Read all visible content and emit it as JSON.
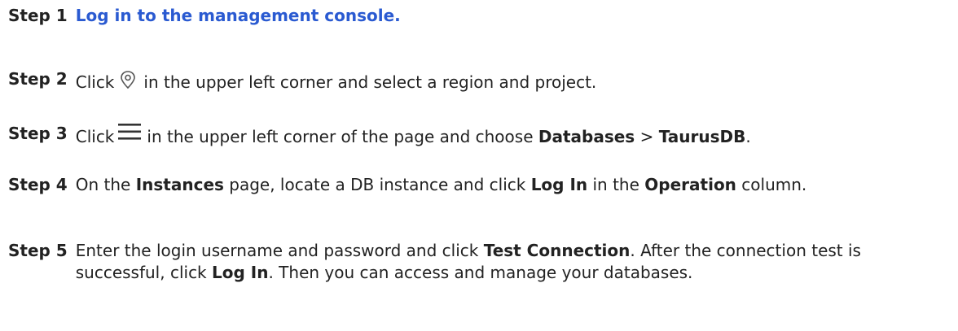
{
  "steps": [
    {
      "label": "Step 1",
      "link": "Log in to the management console."
    },
    {
      "label": "Step 2",
      "before_icon": "Click",
      "icon": "location-pin-icon",
      "after_icon": "in the upper left corner and select a region and project."
    },
    {
      "label": "Step 3",
      "before_icon": "Click",
      "icon": "hamburger-menu-icon",
      "text_a": "in the upper left corner of the page and choose",
      "bold_a": "Databases",
      "sep": ">",
      "bold_b": "TaurusDB",
      "text_end": "."
    },
    {
      "label": "Step 4",
      "text_a": "On the",
      "bold_a": "Instances",
      "text_b": "page, locate a DB instance and click",
      "bold_b": "Log In",
      "text_c": "in the",
      "bold_c": "Operation",
      "text_d": "column."
    },
    {
      "label": "Step 5",
      "text_a": "Enter the login username and password and click",
      "bold_a": "Test Connection",
      "text_b": ". After the connection test is successful, click",
      "bold_b": "Log In",
      "text_c": ". Then you can access and manage your databases."
    }
  ]
}
